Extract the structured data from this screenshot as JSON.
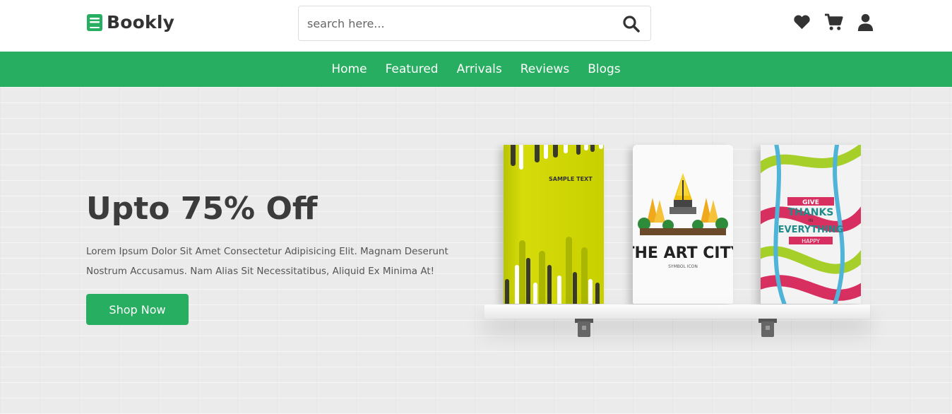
{
  "header": {
    "logo_text": "Bookly",
    "search_placeholder": "search here...",
    "icons": [
      "heart-icon",
      "cart-icon",
      "user-icon"
    ]
  },
  "nav": {
    "items": [
      "Home",
      "Featured",
      "Arrivals",
      "Reviews",
      "Blogs"
    ]
  },
  "hero": {
    "title": "Upto 75% Off",
    "description": "Lorem Ipsum Dolor Sit Amet Consectetur Adipisicing Elit. Magnam Deserunt Nostrum Accusamus. Nam Alias Sit Necessitatibus, Aliquid Ex Minima At!",
    "button_label": "Shop Now"
  },
  "books": [
    {
      "cover_text": "SAMPLE TEXT"
    },
    {
      "cover_title": "THE ART CITY",
      "cover_subtitle": "SYMBOL ICON"
    },
    {
      "cover_lines": [
        "GIVE",
        "THANKS",
        "IN",
        "EVERYTHING",
        "HAPPY"
      ]
    }
  ],
  "colors": {
    "brand_green": "#27ae60",
    "text_dark": "#3b3b3b",
    "book1_green": "#c9d000"
  }
}
